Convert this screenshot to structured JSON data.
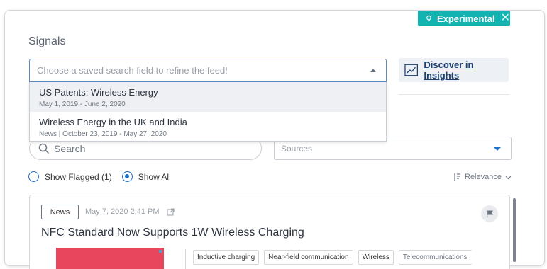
{
  "experimental": {
    "label": "Experimental"
  },
  "signals": {
    "title": "Signals"
  },
  "saved_search": {
    "placeholder": "Choose a saved search field to refine the feed!",
    "options": [
      {
        "title": "US Patents: Wireless Energy",
        "subtitle": "May 1, 2019 - June 2, 2020"
      },
      {
        "title": "Wireless Energy in the UK and India",
        "subtitle": "News | October 23, 2019 - May 27, 2020"
      }
    ]
  },
  "discover": {
    "label": "Discover in Insights"
  },
  "search": {
    "placeholder": "Search"
  },
  "sources": {
    "placeholder": "Sources"
  },
  "filters": {
    "flagged": "Show Flagged (1)",
    "all": "Show All"
  },
  "sort": {
    "label": "Relevance"
  },
  "card": {
    "tag": "News",
    "date": "May 7, 2020 2:41 PM",
    "title": "NFC Standard Now Supports 1W Wireless Charging",
    "tags": [
      "Inductive charging",
      "Near-field communication",
      "Wireless",
      "Telecommunications"
    ]
  },
  "colors": {
    "accent": "#12b3b0",
    "primary": "#1b6fc8",
    "link": "#1b3e6e"
  }
}
